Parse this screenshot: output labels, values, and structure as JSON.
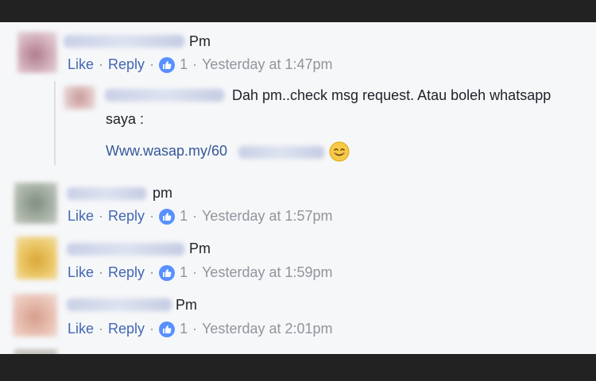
{
  "actions": {
    "like_label": "Like",
    "reply_label": "Reply",
    "separator": "·"
  },
  "comments": [
    {
      "text": "Pm",
      "likes": "1",
      "timestamp": "Yesterday at 1:47pm"
    },
    {
      "text": "Dah pm..check msg request. Atau boleh whatsapp",
      "text_cont": "saya :",
      "link": "Www.wasap.my/60"
    },
    {
      "text": "pm",
      "likes": "1",
      "timestamp": "Yesterday at 1:57pm"
    },
    {
      "text": "Pm",
      "likes": "1",
      "timestamp": "Yesterday at 1:59pm"
    },
    {
      "text": "Pm",
      "likes": "1",
      "timestamp": "Yesterday at 2:01pm"
    }
  ],
  "icons": {
    "like": "thumbs-up-icon",
    "emoji": "smiling-face-icon"
  },
  "colors": {
    "link": "#4267b2",
    "meta": "#90949c",
    "text": "#1d2129",
    "like_badge": "#5890ff",
    "background": "#f6f7f9"
  }
}
